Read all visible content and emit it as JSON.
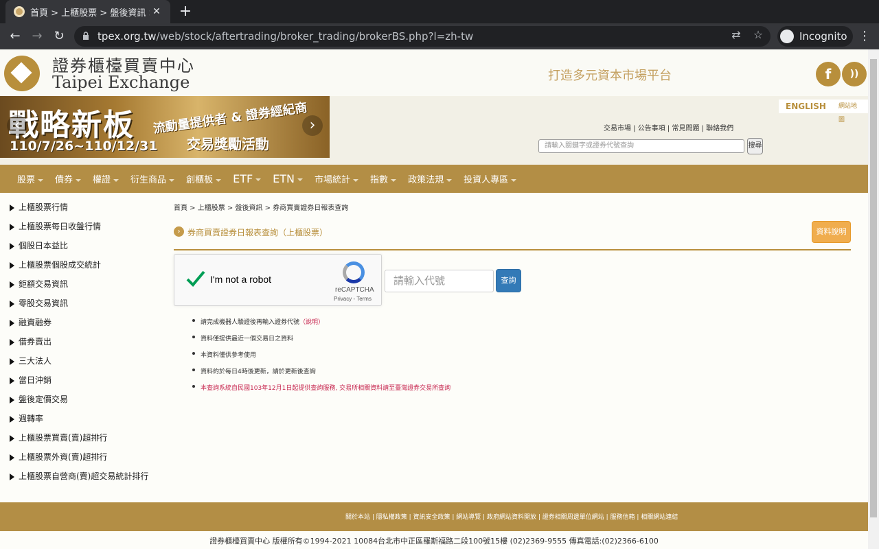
{
  "browser": {
    "tab_title": "首頁 > 上櫃股票 > 盤後資訊 > 券商買賣證券日報表",
    "url_host": "tpex.org.tw",
    "url_path": "/web/stock/aftertrading/broker_trading/brokerBS.php?l=zh-tw",
    "profile_label": "Incognito"
  },
  "header": {
    "logo_cn": "證券櫃檯買賣中心",
    "logo_en": "Taipei Exchange",
    "slogan": "打造多元資本市場平台",
    "facebook_glyph": "f",
    "rss_glyph": "))"
  },
  "banner": {
    "title": "戰略新板",
    "date": "110/7/26~110/12/31",
    "sub1": "流動量提供者 & 證券經紀商",
    "sub2": "交易獎勵活動"
  },
  "utility": {
    "lang_en": "ENGLISH",
    "lang_other": "網站地圖",
    "toplinks": "交易市場 | 公告事項 | 常見問題 | 聯絡我們",
    "search_placeholder": "請輸入關鍵字或證券代號查詢",
    "search_button": "搜尋"
  },
  "nav": [
    {
      "label": "股票",
      "big": false
    },
    {
      "label": "債券",
      "big": false
    },
    {
      "label": "權證",
      "big": false
    },
    {
      "label": "衍生商品",
      "big": false
    },
    {
      "label": "創櫃板",
      "big": false
    },
    {
      "label": "ETF",
      "big": true
    },
    {
      "label": "ETN",
      "big": true
    },
    {
      "label": "市場統計",
      "big": false
    },
    {
      "label": "指數",
      "big": false
    },
    {
      "label": "政策法規",
      "big": false
    },
    {
      "label": "投資人專區",
      "big": false
    }
  ],
  "sidebar": [
    "上櫃股票行情",
    "上櫃股票每日收盤行情",
    "個股日本益比",
    "上櫃股票個股成交統計",
    "鉅額交易資訊",
    "零股交易資訊",
    "融資融券",
    "借券賣出",
    "三大法人",
    "當日沖銷",
    "盤後定價交易",
    "週轉率",
    "上櫃股票買賣(賣)超排行",
    "上櫃股票外資(賣)超排行",
    "上櫃股票自營商(賣)超交易統計排行"
  ],
  "content": {
    "breadcrumb": "首頁 > 上櫃股票 > 盤後資訊 > 券商買賣證券日報表查詢",
    "title": "券商買賣證券日報表查詢（上櫃股票）",
    "orange_button": "資料說明",
    "recaptcha_label": "I'm not a robot",
    "recaptcha_brand": "reCAPTCHA",
    "recaptcha_terms": "Privacy - Terms",
    "code_placeholder": "請輸入代號",
    "query_button": "查詢",
    "notes": [
      {
        "text": "請完成機器人驗證後再輸入證券代號",
        "link": "（說明）",
        "red": false
      },
      {
        "text": "資料僅提供最近一個交易日之資料",
        "link": "",
        "red": false
      },
      {
        "text": "本資料僅供參考使用",
        "link": "",
        "red": false
      },
      {
        "text": "資料約於每日4時後更新，請於更新後查詢",
        "link": "",
        "red": false
      },
      {
        "text": "本查詢系統自民國103年12月1日起提供查詢服務, 交易所相關資料請至臺灣證券交易所查詢",
        "link": "",
        "red": true
      }
    ]
  },
  "footer": {
    "links": "關於本站 | 隱私權政策 | 資訊安全政策 | 網站導覽 | 政府網站資料開放 | 證券相關周邊單位網站 | 服務信箱 | 相關網站連結",
    "copyright": "證券櫃檯買賣中心 版權所有©1994-2021  10084台北市中正區羅斯福路二段100號15樓 (02)2369-9555 傳真電話:(02)2366-6100"
  }
}
